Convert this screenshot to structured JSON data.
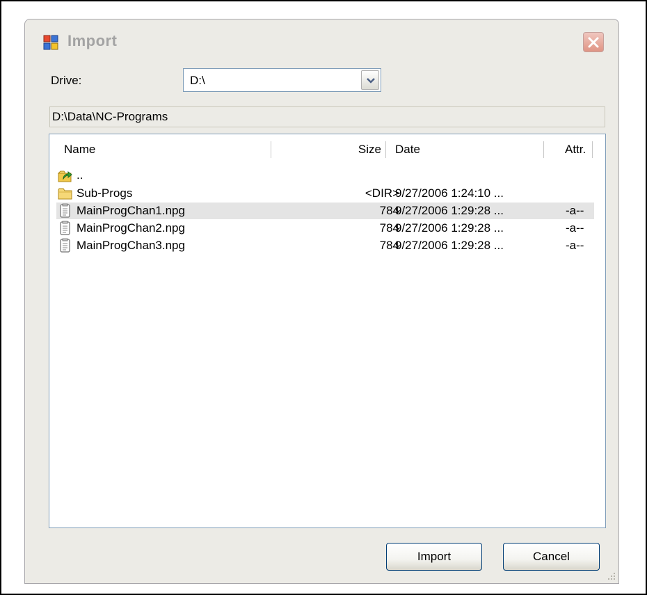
{
  "window": {
    "title": "Import",
    "app_icon": "app-window-icon",
    "close_icon": "close-icon"
  },
  "drive": {
    "label": "Drive:",
    "value": "D:\\",
    "arrow_icon": "chevron-down-icon"
  },
  "path": "D:\\Data\\NC-Programs",
  "list": {
    "columns": [
      "Name",
      "Size",
      "Date",
      "Attr."
    ],
    "rows": [
      {
        "icon": "folder-up-icon",
        "name": "..",
        "size": "",
        "date": "",
        "attr": ""
      },
      {
        "icon": "folder-icon",
        "name": "Sub-Progs",
        "size": "<DIR>",
        "date": "9/27/2006 1:24:10 ...",
        "attr": ""
      },
      {
        "icon": "file-icon",
        "name": "MainProgChan1.npg",
        "size": "784",
        "date": "9/27/2006 1:29:28 ...",
        "attr": "-a--"
      },
      {
        "icon": "file-icon",
        "name": "MainProgChan2.npg",
        "size": "784",
        "date": "9/27/2006 1:29:28 ...",
        "attr": "-a--"
      },
      {
        "icon": "file-icon",
        "name": "MainProgChan3.npg",
        "size": "784",
        "date": "9/27/2006 1:29:28 ...",
        "attr": "-a--"
      }
    ],
    "selected_row": 2
  },
  "buttons": {
    "import_label": "Import",
    "cancel_label": "Cancel"
  },
  "colors": {
    "dialog_bg": "#ecebe6",
    "selection": "#e4e4e4",
    "title_text": "#a3a3a3",
    "border_blue": "#7f9db9"
  }
}
